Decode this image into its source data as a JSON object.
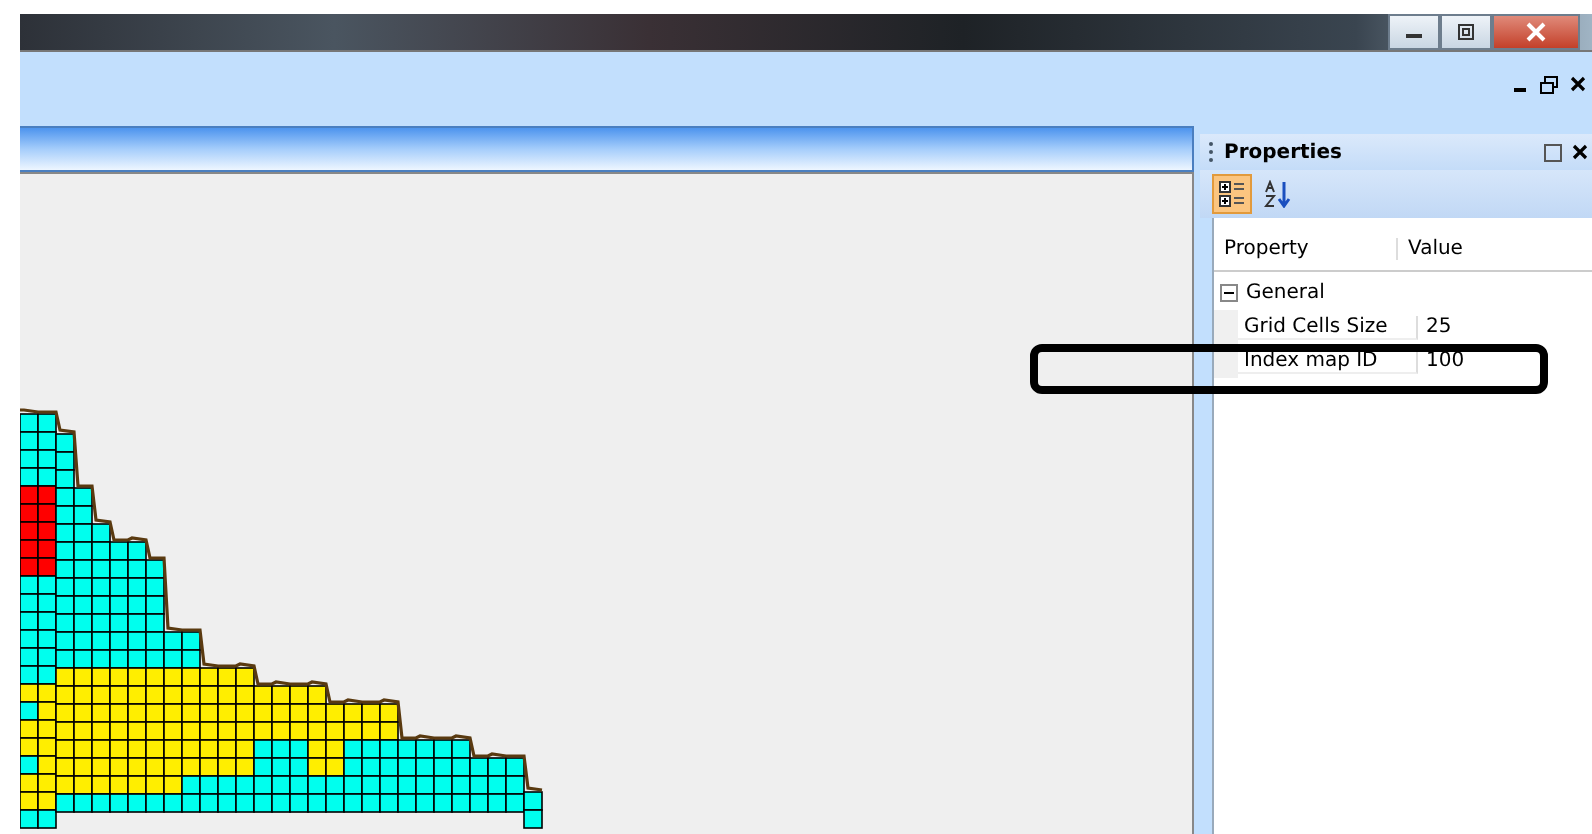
{
  "properties_panel": {
    "title": "Properties",
    "toolbar": [
      {
        "kind": "categorized",
        "selected": true
      },
      {
        "kind": "alphabetical",
        "selected": false
      }
    ],
    "columns": [
      "Property",
      "Value"
    ],
    "categories": [
      {
        "name": "General",
        "expanded": true,
        "rows": [
          {
            "name": "Grid Cells Size",
            "value": "25"
          },
          {
            "name": "Index map ID",
            "value": "100",
            "highlighted": true
          }
        ]
      }
    ]
  }
}
